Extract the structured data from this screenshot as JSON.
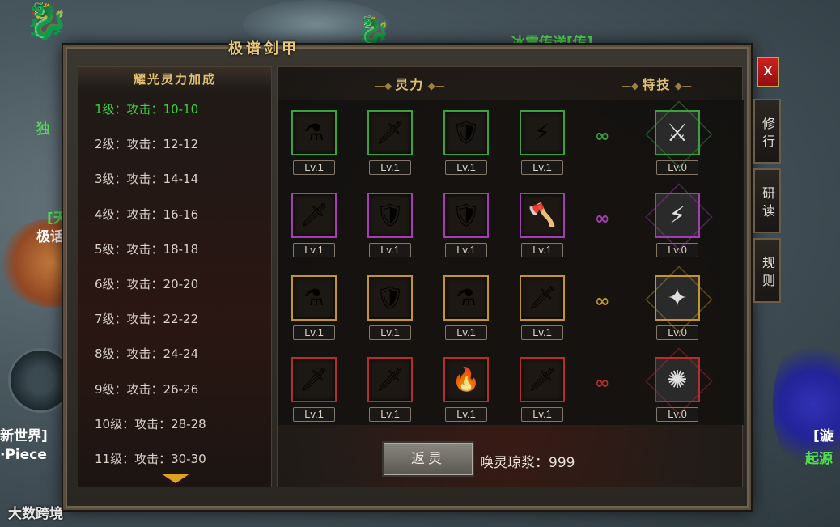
{
  "window": {
    "title": "极谱剑甲",
    "close_label": "X"
  },
  "background": {
    "portal_label": "冰雪传送[传]",
    "left_label_1": "独",
    "left_label_2": "[天",
    "left_label_3": "极话",
    "left_label_4": "新世界]",
    "left_label_5": "·Piece",
    "right_label_1": "[漩",
    "right_label_2": "起源"
  },
  "bonus_list": {
    "header": "耀光灵力加成",
    "levels": [
      "1级：攻击：10-10",
      "2级：攻击：12-12",
      "3级：攻击：14-14",
      "4级：攻击：16-16",
      "5级：攻击：18-18",
      "6级：攻击：20-20",
      "7级：攻击：22-22",
      "8级：攻击：24-24",
      "9级：攻击：26-26",
      "10级：攻击：28-28",
      "11级：攻击：30-30"
    ]
  },
  "sections": {
    "spirit_title": "灵力",
    "skill_title": "特技"
  },
  "rows": [
    {
      "color": "#3fae3f",
      "items": [
        {
          "icon": "red-potion-icon",
          "glyph": "⚗",
          "level": "Lv.1"
        },
        {
          "icon": "sword-icon",
          "glyph": "🗡",
          "level": "Lv.1"
        },
        {
          "icon": "armor-icon",
          "glyph": "🛡",
          "level": "Lv.1"
        },
        {
          "icon": "lightning-sword-icon",
          "glyph": "⚡",
          "level": "Lv.1"
        }
      ],
      "skill": {
        "icon": "slash-skill-icon",
        "glyph": "⚔",
        "level": "Lv.0"
      }
    },
    {
      "color": "#b040c0",
      "items": [
        {
          "icon": "golden-blade-icon",
          "glyph": "🗡",
          "level": "Lv.1"
        },
        {
          "icon": "silver-armor-icon",
          "glyph": "🛡",
          "level": "Lv.1"
        },
        {
          "icon": "armor-icon",
          "glyph": "🛡",
          "level": "Lv.1"
        },
        {
          "icon": "flame-axe-icon",
          "glyph": "🪓",
          "level": "Lv.1"
        }
      ],
      "skill": {
        "icon": "lightning-skill-icon",
        "glyph": "⚡",
        "level": "Lv.0"
      }
    },
    {
      "color": "#d0a030",
      "items": [
        {
          "icon": "red-potion-icon",
          "glyph": "⚗",
          "level": "Lv.1"
        },
        {
          "icon": "silver-armor-icon",
          "glyph": "🛡",
          "level": "Lv.1"
        },
        {
          "icon": "red-potion-icon",
          "glyph": "⚗",
          "level": "Lv.1"
        },
        {
          "icon": "golden-blade-icon",
          "glyph": "🗡",
          "level": "Lv.1"
        }
      ],
      "skill": {
        "icon": "shield-skill-icon",
        "glyph": "✦",
        "level": "Lv.0"
      }
    },
    {
      "color": "#c03030",
      "items": [
        {
          "icon": "sword-icon",
          "glyph": "🗡",
          "level": "Lv.1"
        },
        {
          "icon": "sword-icon",
          "glyph": "🗡",
          "level": "Lv.1"
        },
        {
          "icon": "fire-blade-icon",
          "glyph": "🔥",
          "level": "Lv.1"
        },
        {
          "icon": "golden-blade-icon",
          "glyph": "🗡",
          "level": "Lv.1"
        }
      ],
      "skill": {
        "icon": "burst-skill-icon",
        "glyph": "✺",
        "level": "Lv.0"
      }
    }
  ],
  "footer": {
    "return_button": "返灵",
    "currency_text": "唤灵琼浆：999"
  },
  "tabs": [
    "修行",
    "研读",
    "规则"
  ],
  "watermark": "大数跨境"
}
